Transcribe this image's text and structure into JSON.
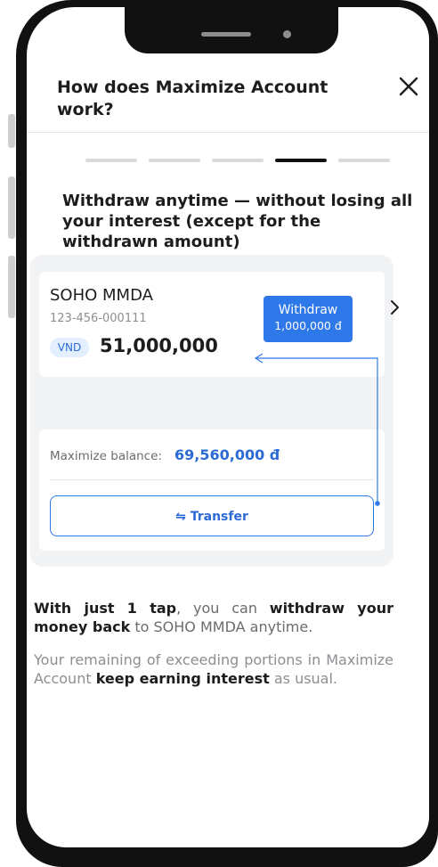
{
  "header": {
    "title": "How does Maximize Account work?",
    "close_icon": "close-icon"
  },
  "steps": {
    "total": 5,
    "active": 4
  },
  "heading": "Withdraw anytime — without losing all your interest (except for the withdrawn amount)",
  "account": {
    "name": "SOHO MMDA",
    "number": "123-456-000111",
    "currency": "VND",
    "balance": "51,000,000"
  },
  "withdraw_badge": {
    "label": "Withdraw",
    "amount": "1,000,000 đ"
  },
  "maximize": {
    "label": "Maximize balance:",
    "value": "69,560,000 đ"
  },
  "transfer_button": {
    "icon": "transfer-icon",
    "label": "Transfer"
  },
  "paragraph1": {
    "b1": "With just 1 tap",
    "t1": ", you can ",
    "b2": "withdraw your money back",
    "t2": " to SOHO MMDA anytime."
  },
  "paragraph2": {
    "t1": "Your remaining of exceeding portions in Maximize Account ",
    "b1": "keep earning interest",
    "t2": " as usual."
  },
  "colors": {
    "accent": "#2f78ea",
    "text": "#1d1d1f",
    "muted": "#8e8e93",
    "panel": "#f2f3f5"
  }
}
